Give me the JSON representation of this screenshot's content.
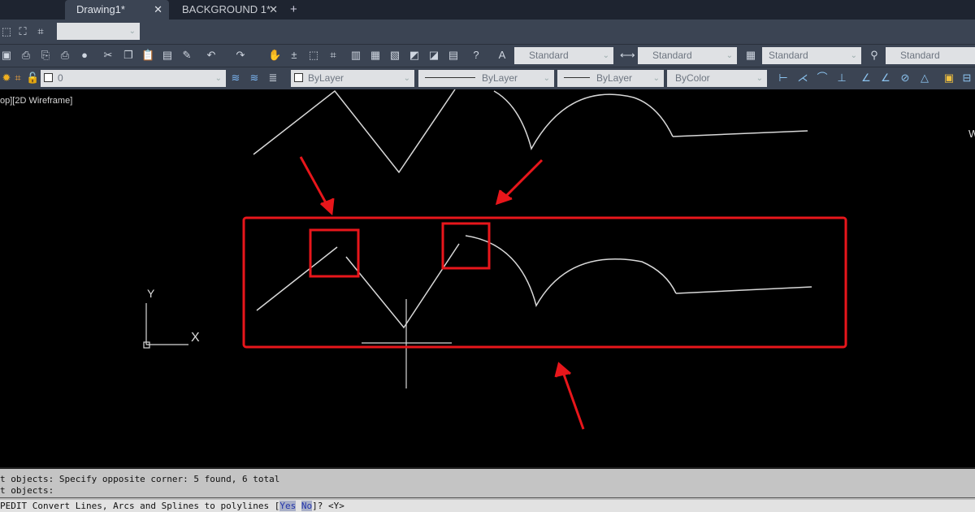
{
  "tabs": [
    {
      "label": "Drawing1*",
      "active": true
    },
    {
      "label": "BACKGROUND 1*",
      "active": false
    }
  ],
  "tab_close": "✕",
  "new_tab": "+",
  "toolbar": {
    "workspace_value": "",
    "text_style": "Standard",
    "dim_style": "Standard",
    "table_style": "Standard",
    "mleader_style": "Standard",
    "layer": "0",
    "color": "ByLayer",
    "linetype": "ByLayer",
    "lineweight": "ByLayer",
    "plot_style": "ByColor"
  },
  "viewport": {
    "label": "op][2D Wireframe]",
    "ucs_x": "X",
    "ucs_y": "Y",
    "edge_letter": "W"
  },
  "command": {
    "history": [
      "t objects: Specify opposite corner: 5 found, 6 total",
      "t objects:"
    ],
    "prompt_prefix": "PEDIT Convert Lines, Arcs and Splines to polylines [",
    "opt_yes": "Yes",
    "opt_no": "No",
    "prompt_suffix": "]? <Y>"
  },
  "colors": {
    "annotation": "#e8161b",
    "geometry": "#d8d8d8"
  }
}
